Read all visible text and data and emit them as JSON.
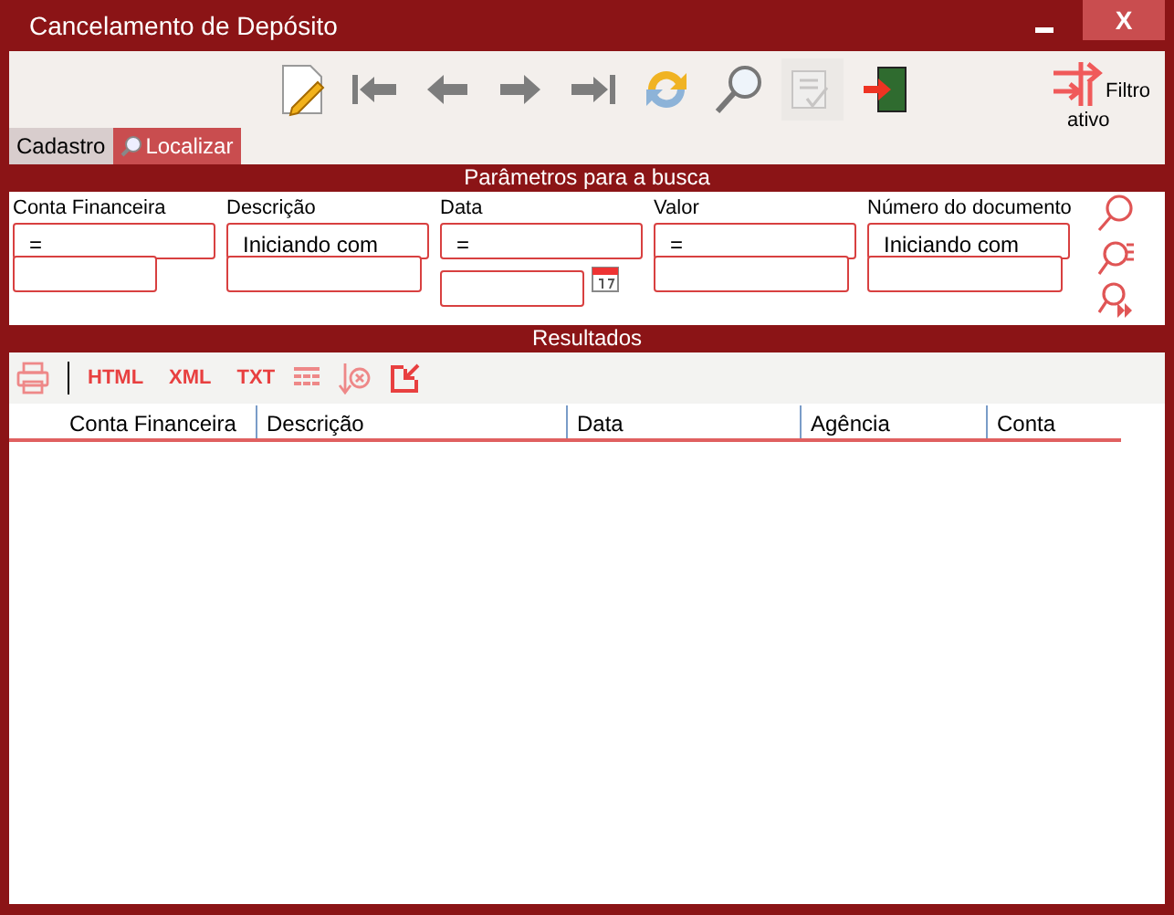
{
  "window": {
    "title": "Cancelamento de Depósito",
    "close": "X"
  },
  "toolbar": [
    {
      "kind": "new",
      "disabled": false
    },
    {
      "kind": "first",
      "disabled": false
    },
    {
      "kind": "prev",
      "disabled": false
    },
    {
      "kind": "next",
      "disabled": false
    },
    {
      "kind": "last",
      "disabled": false
    },
    {
      "kind": "refresh",
      "disabled": false
    },
    {
      "kind": "search",
      "disabled": false
    },
    {
      "kind": "confirm",
      "disabled": true
    },
    {
      "kind": "exit",
      "disabled": false
    }
  ],
  "filter": {
    "label": "Filtro",
    "label_2": "ativo"
  },
  "tabs": [
    {
      "label": "Cadastro",
      "selected": false
    },
    {
      "label": "Localizar",
      "selected": true
    }
  ],
  "params": {
    "title": "Parâmetros para a busca",
    "fields": [
      {
        "label": "Conta Financeira",
        "operator": "=",
        "kind": "plain"
      },
      {
        "label": "Descrição",
        "operator": "Iniciando com",
        "kind": "plain"
      },
      {
        "label": "Data",
        "operator": "=",
        "kind": "date"
      },
      {
        "label": "Valor",
        "operator": "=",
        "kind": "plain"
      },
      {
        "label": "Número do documento",
        "operator": "Iniciando com",
        "kind": "plain"
      }
    ]
  },
  "results": {
    "title": "Resultados",
    "exports": [
      "HTML",
      "XML",
      "TXT"
    ],
    "columns": [
      "Conta Financeira",
      "Descrição",
      "Data",
      "Agência",
      "Conta"
    ]
  }
}
